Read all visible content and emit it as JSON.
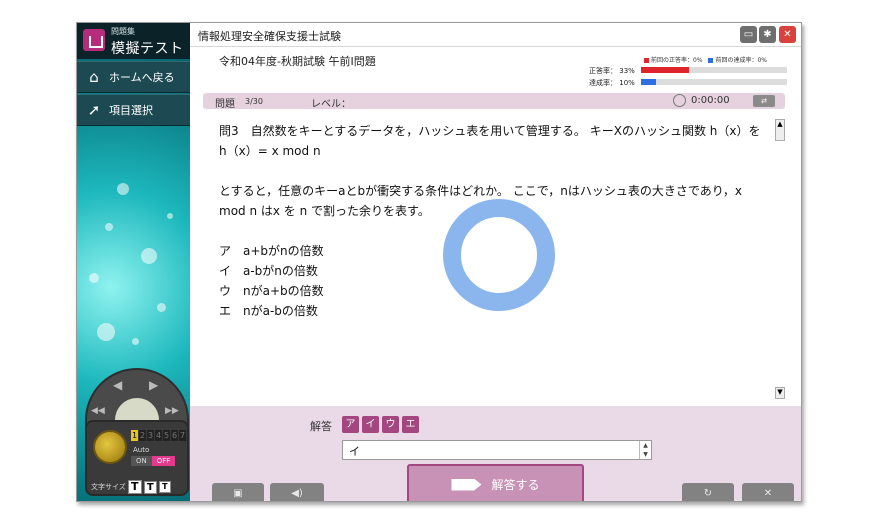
{
  "sidebar": {
    "logo_subtitle": "問題集",
    "logo_title": "模擬テスト",
    "home_label": "ホームへ戻る",
    "select_label": "項目選択"
  },
  "window": {
    "title": "情報処理安全確保支援士試験"
  },
  "exam": {
    "name": "令和04年度-秋期試験 午前Ⅰ問題",
    "correct_rate_label": "正答率：",
    "correct_rate_value": "33%",
    "correct_rate": 0.33,
    "achievement_label": "達成率：",
    "achievement_value": "10%",
    "achievement_rate": 0.1,
    "legend_prev_correct": "前回の正答率：",
    "legend_prev_correct_value": "0%",
    "legend_prev_achieve": "前回の達成率：",
    "legend_prev_achieve_value": "0%"
  },
  "question_header": {
    "label": "問題",
    "number": "3/30",
    "level_label": "レベル：",
    "timer": "0:00:00"
  },
  "question": {
    "text": "問3　自然数をキーとするデータを，ハッシュ表を用いて管理する。 キーXのハッシュ関数 h（x）を\nh（x）= x mod n\n\nとすると，任意のキーaとbが衝突する条件はどれか。 ここで，nはハッシュ表の大きさであり，x mod n はx を n で割った余りを表す。\n\nア　a+bがnの倍数\nイ　a-bがnの倍数\nウ　nがa+bの倍数\nエ　nがa-bの倍数"
  },
  "answer": {
    "label": "解答",
    "choices": [
      "ア",
      "イ",
      "ウ",
      "エ"
    ],
    "value": "イ",
    "submit_label": "解答する"
  },
  "controls": {
    "digits": [
      "1",
      "2",
      "3",
      "4",
      "5",
      "6",
      "7"
    ],
    "auto_label": "Auto",
    "on_label": "ON",
    "off_label": "OFF",
    "font_size_label": "文字サイズ",
    "font_sizes": [
      "T",
      "T",
      "T"
    ]
  },
  "colors": {
    "accent": "#a4467f",
    "correct_bar": "#e0242b",
    "achieve_bar": "#2f6fe0",
    "close_button": "#d9413c"
  },
  "icons": {
    "home": "home-icon",
    "select": "pointer-icon",
    "folder": "folder-icon",
    "gear": "gear-icon",
    "close": "close-icon",
    "clock": "clock-icon",
    "loading": "loading-spinner-icon"
  }
}
